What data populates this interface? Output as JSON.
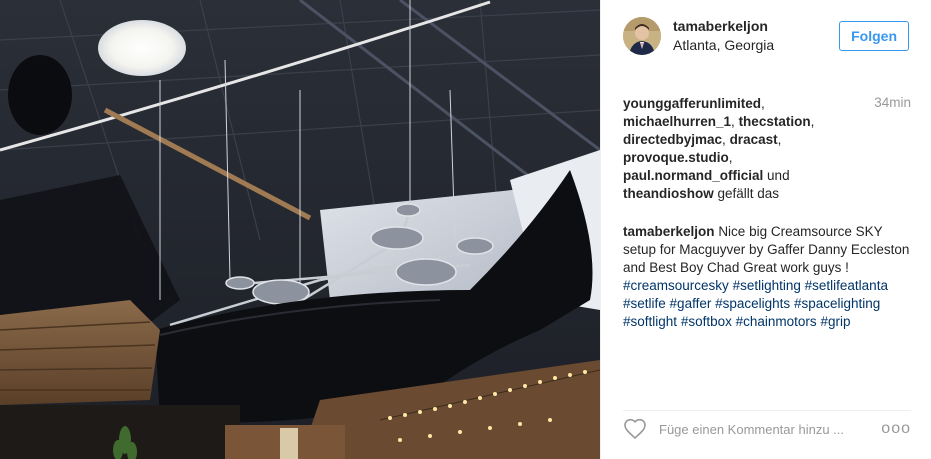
{
  "post": {
    "username": "tamaberkeljon",
    "location": "Atlanta, Georgia",
    "follow_label": "Folgen",
    "time_ago": "34min",
    "likes": {
      "users": [
        "younggafferunlimited",
        "michaelhurren_1",
        "thecstation",
        "directedbyjmac",
        "dracast",
        "provoque.studio",
        "paul.normand_official",
        "theandioshow"
      ],
      "and_word": "und",
      "suffix": "gefällt das"
    },
    "caption": {
      "author": "tamaberkeljon",
      "text": "Nice big Creamsource SKY setup for Macguyver by Gaffer Danny Eccleston and Best Boy Chad Great work guys !",
      "hashtags": [
        "#creamsourcesky",
        "#setlighting",
        "#setlifeatlanta",
        "#setlife",
        "#gaffer",
        "#spacelights",
        "#spacelighting",
        "#softlight",
        "#softbox",
        "#chainmotors",
        "#grip"
      ]
    },
    "comment_placeholder": "Füge einen Kommentar hinzu ...",
    "more_glyph": "ooo"
  },
  "icons": {
    "heart": "heart-outline-icon",
    "more": "more-options-icon"
  },
  "colors": {
    "accent": "#3897f0",
    "hashtag": "#003569",
    "muted": "#999999",
    "text": "#262626"
  }
}
